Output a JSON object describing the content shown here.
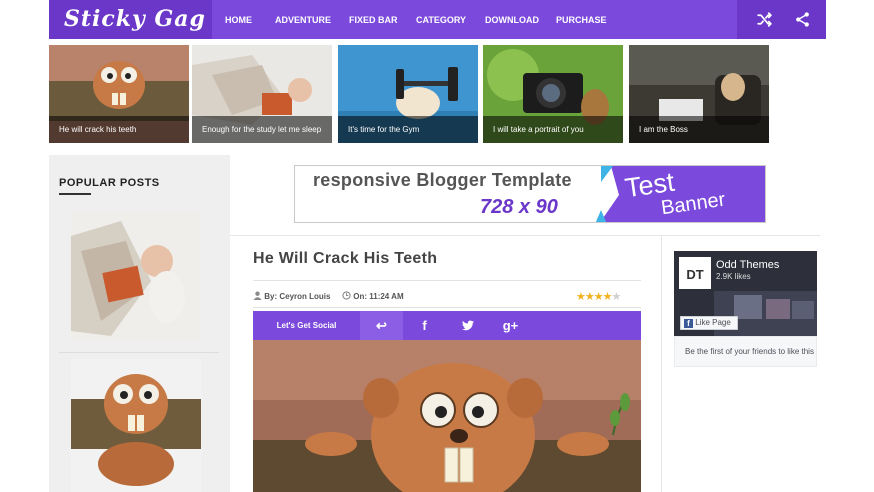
{
  "brand": {
    "logo_text": "Sticky Gag",
    "accent": "#7b49dc",
    "accent_dark": "#6a37c9"
  },
  "nav": {
    "items": [
      "HOME",
      "ADVENTURE",
      "FIXED BAR",
      "CATEGORY",
      "DOWNLOAD",
      "PURCHASE"
    ],
    "icons": [
      "shuffle-icon",
      "share-icon"
    ]
  },
  "featured": [
    {
      "caption": "He will crack his teeth",
      "image": "beaver-cartoon"
    },
    {
      "caption": "Enough for the study let me sleep",
      "image": "sleeping-baby"
    },
    {
      "caption": "It's time for the Gym",
      "image": "dog-dumbbell"
    },
    {
      "caption": "I will take a portrait of you",
      "image": "chipmunk-camera"
    },
    {
      "caption": "I am the Boss",
      "image": "pug-chair"
    }
  ],
  "sidebar": {
    "popular_title": "POPULAR POSTS"
  },
  "banner": {
    "left_text": "responsive  Blogger  Template",
    "size_text": "728 x 90",
    "test_text": "Test",
    "sub_text": "Banner"
  },
  "post": {
    "title": "He Will Crack His Teeth",
    "author": "By: Ceyron Louis",
    "time": "On: 11:24 AM",
    "rating": 4,
    "rating_max": 5
  },
  "social": {
    "label": "Let's Get Social",
    "buttons": [
      "↩",
      "f",
      "t",
      "g+"
    ]
  },
  "fb_widget": {
    "page_name": "Odd Themes",
    "likes": "2.9K likes",
    "like_button": "Like Page",
    "footer": "Be the first of your friends to like this"
  }
}
